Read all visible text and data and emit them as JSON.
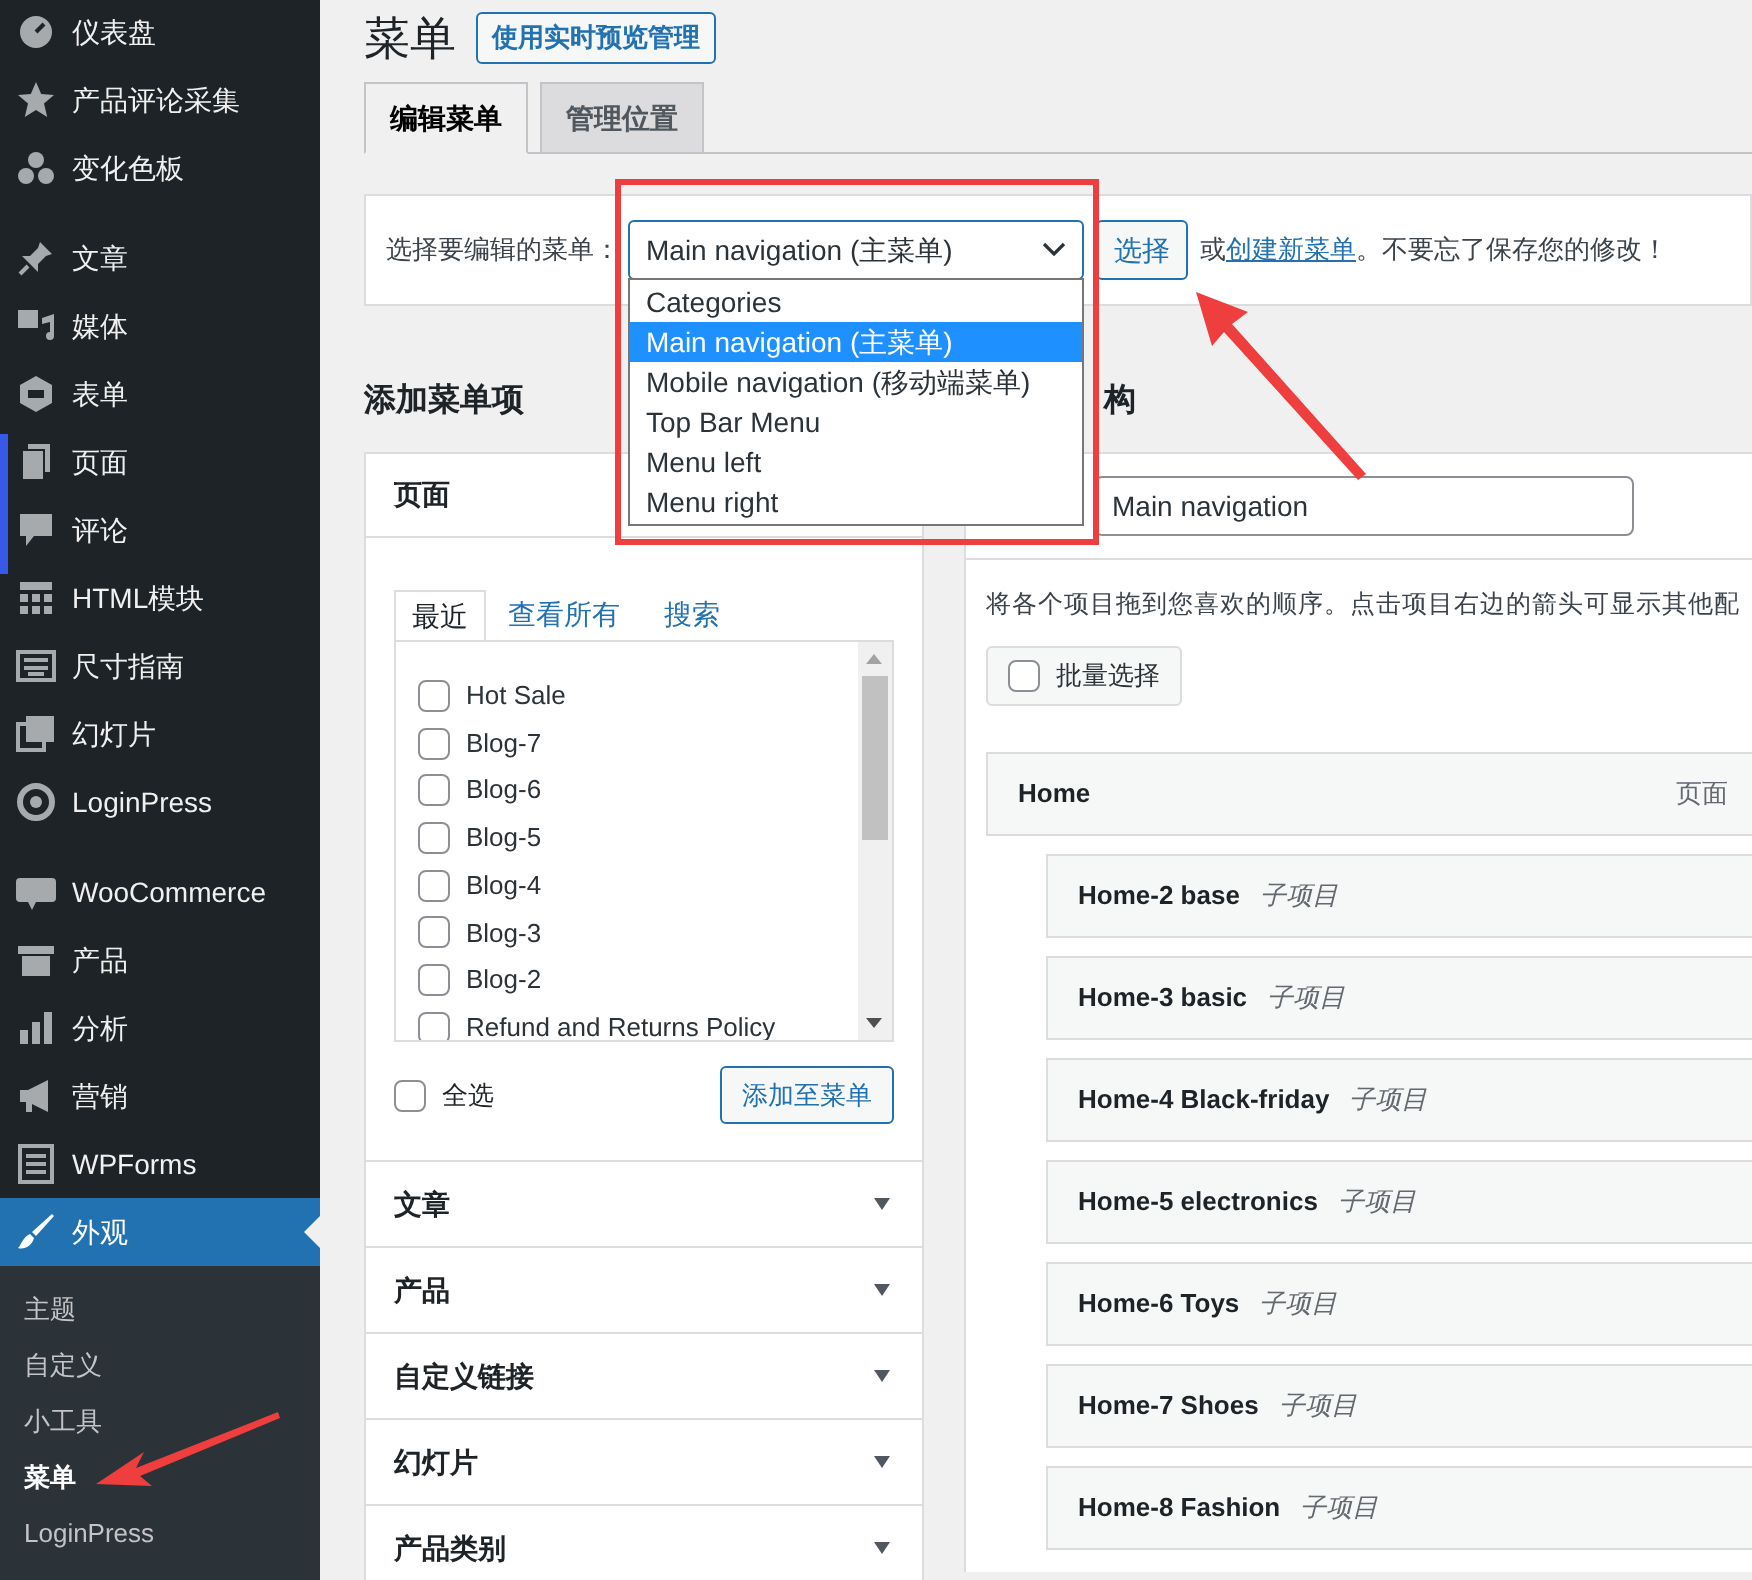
{
  "sidebar": {
    "groups": [
      [
        {
          "label": "仪表盘",
          "selected": false
        },
        {
          "label": "产品评论采集",
          "selected": false
        },
        {
          "label": "变化色板",
          "selected": false
        }
      ],
      [
        {
          "label": "文章",
          "selected": false
        },
        {
          "label": "媒体",
          "selected": false
        },
        {
          "label": "表单",
          "selected": false
        },
        {
          "label": "页面",
          "selected": false
        },
        {
          "label": "评论",
          "selected": false
        },
        {
          "label": "HTML模块",
          "selected": false
        },
        {
          "label": "尺寸指南",
          "selected": false
        },
        {
          "label": "幻灯片",
          "selected": false
        },
        {
          "label": "LoginPress",
          "selected": false
        }
      ],
      [
        {
          "label": "WooCommerce",
          "selected": false
        },
        {
          "label": "产品",
          "selected": false
        },
        {
          "label": "分析",
          "selected": false
        },
        {
          "label": "营销",
          "selected": false
        },
        {
          "label": "WPForms",
          "selected": false
        },
        {
          "label": "外观",
          "selected": true
        }
      ]
    ],
    "submenu": [
      {
        "label": "主题",
        "selected": false
      },
      {
        "label": "自定义",
        "selected": false
      },
      {
        "label": "小工具",
        "selected": false
      },
      {
        "label": "菜单",
        "selected": true
      },
      {
        "label": "LoginPress",
        "selected": false
      }
    ]
  },
  "page_title": "菜单",
  "preview_button": "使用实时预览管理",
  "tabs": [
    {
      "label": "编辑菜单",
      "selected": true
    },
    {
      "label": "管理位置",
      "selected": false
    }
  ],
  "menu_select": {
    "label": "选择要编辑的菜单：",
    "value": "Main navigation (主菜单)",
    "button": "选择",
    "before_link": "或",
    "link": "创建新菜单",
    "after_link": "。不要忘了保存您的修改！",
    "options": [
      {
        "label": "Categories",
        "selected": false
      },
      {
        "label": "Main navigation (主菜单)",
        "selected": true
      },
      {
        "label": "Mobile navigation (移动端菜单)",
        "selected": false
      },
      {
        "label": "Top Bar Menu",
        "selected": false
      },
      {
        "label": "Menu left",
        "selected": false
      },
      {
        "label": "Menu right",
        "selected": false
      }
    ]
  },
  "add_items": {
    "title": "添加菜单项",
    "pages": {
      "title": "页面",
      "tabs": [
        {
          "label": "最近",
          "selected": true
        },
        {
          "label": "查看所有",
          "selected": false
        },
        {
          "label": "搜索",
          "selected": false
        }
      ],
      "items": [
        {
          "label": "Hot Sale",
          "checked": false
        },
        {
          "label": "Blog-7",
          "checked": false
        },
        {
          "label": "Blog-6",
          "checked": false
        },
        {
          "label": "Blog-5",
          "checked": false
        },
        {
          "label": "Blog-4",
          "checked": false
        },
        {
          "label": "Blog-3",
          "checked": false
        },
        {
          "label": "Blog-2",
          "checked": false
        },
        {
          "label": "Refund and Returns Policy",
          "checked": false
        }
      ],
      "select_all": {
        "label": "全选",
        "checked": false
      },
      "add_button": "添加至菜单"
    },
    "sections": [
      "文章",
      "产品",
      "自定义链接",
      "幻灯片",
      "产品类别"
    ]
  },
  "structure": {
    "title_fragment": "构",
    "menu_name": "Main navigation",
    "instructions": "将各个项目拖到您喜欢的顺序。点击项目右边的箭头可显示其他配",
    "bulk_select": {
      "label": "批量选择",
      "checked": false
    },
    "items": [
      {
        "label": "Home",
        "type": "页面",
        "children": [
          {
            "label": "Home-2 base",
            "note": "子项目"
          },
          {
            "label": "Home-3 basic",
            "note": "子项目"
          },
          {
            "label": "Home-4 Black-friday",
            "note": "子项目"
          },
          {
            "label": "Home-5 electronics",
            "note": "子项目"
          },
          {
            "label": "Home-6 Toys",
            "note": "子项目"
          },
          {
            "label": "Home-7 Shoes",
            "note": "子项目"
          },
          {
            "label": "Home-8 Fashion",
            "note": "子项目"
          }
        ]
      }
    ]
  }
}
